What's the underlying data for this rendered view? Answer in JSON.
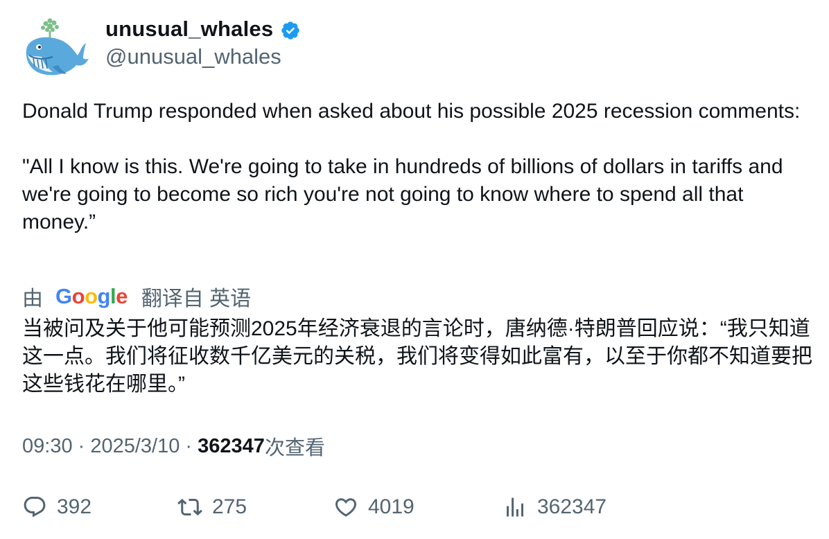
{
  "author": {
    "display_name": "unusual_whales",
    "handle": "@unusual_whales",
    "verified": true,
    "avatar_icon": "whale-avatar-icon",
    "verified_color": "#1d9bf0"
  },
  "tweet": {
    "text_line_1": "Donald Trump responded when asked about his possible 2025 recession comments:",
    "text_line_2": "\"All I know is this. We're going to take in hundreds of billions of dollars in tariffs and we're going to become so rich you're not going to know where to spend all that money.”"
  },
  "translation": {
    "by_label": "由",
    "provider": "Google",
    "translate_label": "翻译自 英语",
    "translated_text": "当被问及关于他可能预测2025年经济衰退的言论时，唐纳德·特朗普回应说：“我只知道这一点。我们将征收数千亿美元的关税，我们将变得如此富有，以至于你都不知道要把这些钱花在哪里。”"
  },
  "meta": {
    "time": "09:30",
    "separator": " · ",
    "date": "2025/3/10",
    "views_count": "362347",
    "views_label": "次查看"
  },
  "actions": {
    "replies": "392",
    "retweets": "275",
    "likes": "4019",
    "views": "362347"
  }
}
